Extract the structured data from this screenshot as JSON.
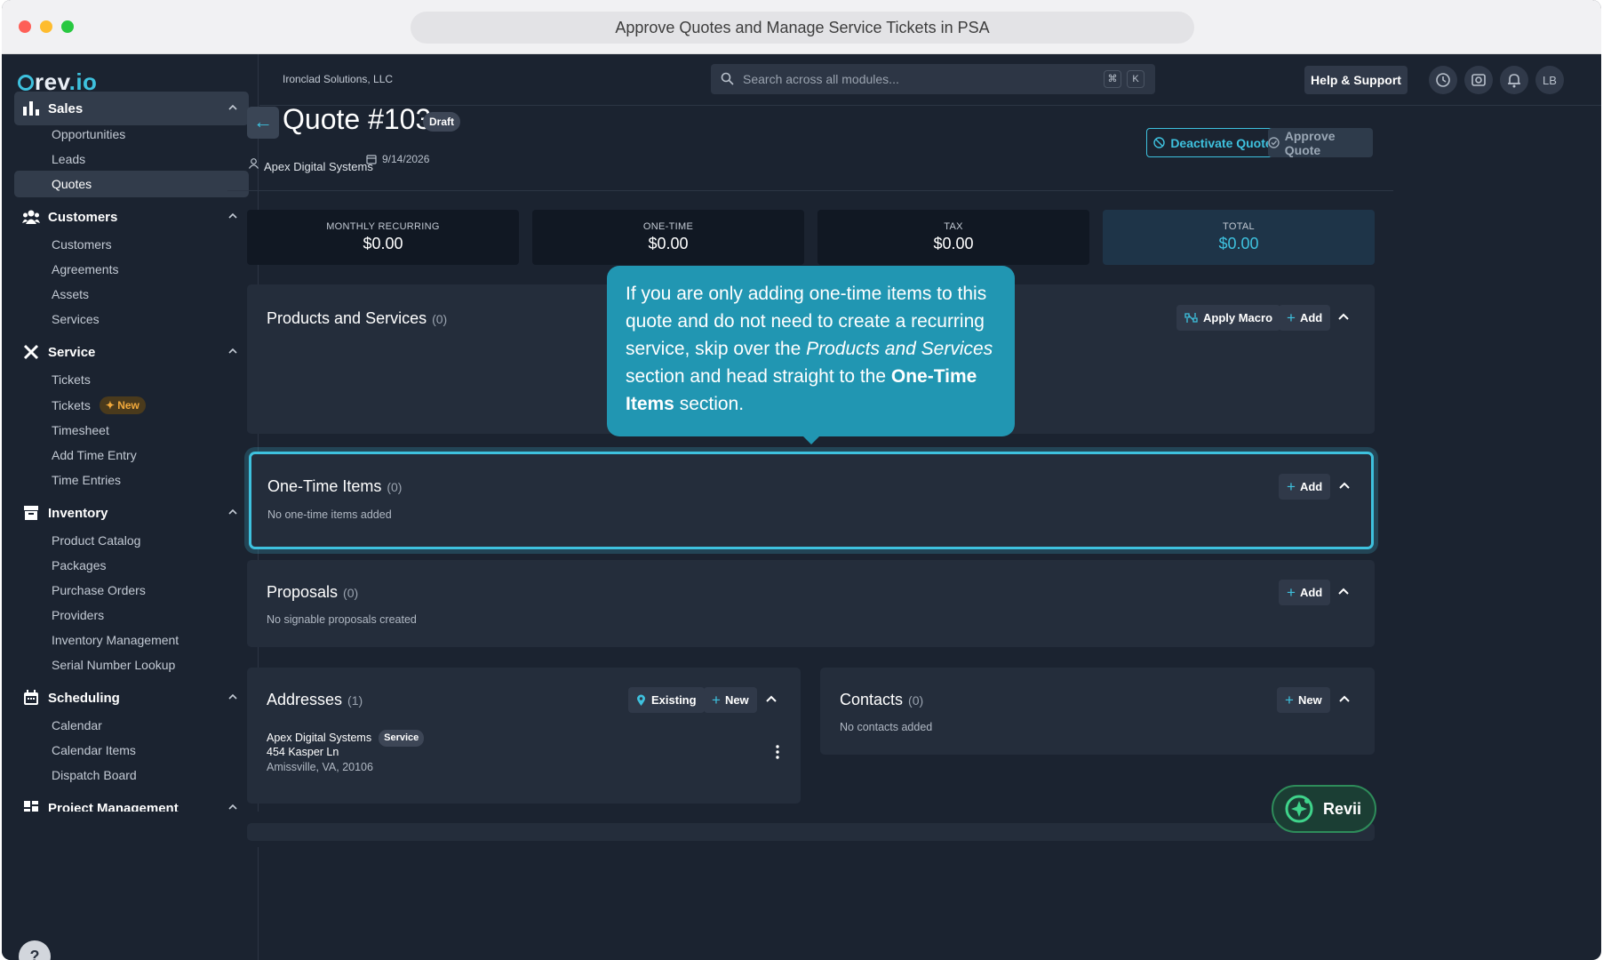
{
  "window": {
    "title": "Approve Quotes and Manage Service Tickets in PSA"
  },
  "logo": {
    "text": "rev",
    "suffix": ".io"
  },
  "sidebar": {
    "sections": [
      {
        "label": "Sales",
        "items": [
          "Opportunities",
          "Leads",
          "Quotes"
        ]
      },
      {
        "label": "Customers",
        "items": [
          "Customers",
          "Agreements",
          "Assets",
          "Services"
        ]
      },
      {
        "label": "Service",
        "items": [
          "Tickets",
          "Tickets",
          "Timesheet",
          "Add Time Entry",
          "Time Entries"
        ]
      },
      {
        "label": "Inventory",
        "items": [
          "Product Catalog",
          "Packages",
          "Purchase Orders",
          "Providers",
          "Inventory Management",
          "Serial Number Lookup"
        ]
      },
      {
        "label": "Scheduling",
        "items": [
          "Calendar",
          "Calendar Items",
          "Dispatch Board"
        ]
      },
      {
        "label": "Project Management",
        "items": []
      }
    ],
    "new_badge": "New",
    "help": "?"
  },
  "header": {
    "company": "Ironclad Solutions, LLC",
    "search_placeholder": "Search across all modules...",
    "kbd1": "⌘",
    "kbd2": "K",
    "help_support": "Help & Support",
    "avatar": "LB"
  },
  "quote": {
    "back": "←",
    "title": "Quote #103",
    "status": "Draft",
    "customer": "Apex Digital Systems",
    "date": "9/14/2026",
    "deactivate": "Deactivate Quote",
    "approve": "Approve Quote"
  },
  "summary": [
    {
      "label": "MONTHLY RECURRING",
      "value": "$0.00"
    },
    {
      "label": "ONE-TIME",
      "value": "$0.00"
    },
    {
      "label": "TAX",
      "value": "$0.00"
    },
    {
      "label": "TOTAL",
      "value": "$0.00"
    }
  ],
  "products": {
    "title": "Products and Services",
    "count": "(0)",
    "apply_macro": "Apply Macro",
    "add": "Add"
  },
  "onetime": {
    "title": "One-Time Items",
    "count": "(0)",
    "empty": "No one-time items added",
    "add": "Add"
  },
  "proposals": {
    "title": "Proposals",
    "count": "(0)",
    "empty": "No signable proposals created",
    "add": "Add"
  },
  "addresses": {
    "title": "Addresses",
    "count": "(1)",
    "existing": "Existing",
    "new": "New",
    "name": "Apex Digital Systems",
    "badge": "Service",
    "line1": "454 Kasper Ln",
    "line2": "Amissville, VA, 20106"
  },
  "contacts": {
    "title": "Contacts",
    "count": "(0)",
    "empty": "No contacts added",
    "new": "New"
  },
  "callout": {
    "t1": "If you are only adding one-time items to this quote and do not need to create a recurring service, skip over the ",
    "t2": "Products and Services",
    "t3": " section and head straight to the ",
    "t4": "One-Time Items",
    "t5": " section."
  },
  "revii": "Revii",
  "colors": {
    "accent": "#3ec1de",
    "background": "#1b2330",
    "panel": "#242d3b",
    "callout": "#2196b2"
  }
}
